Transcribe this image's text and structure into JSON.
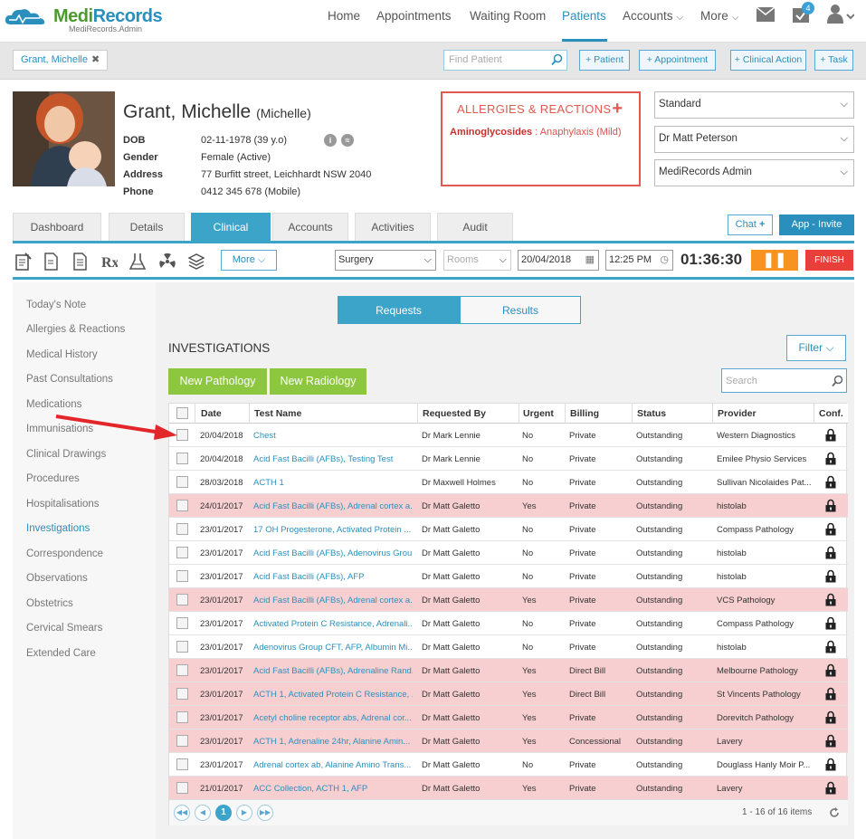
{
  "brand": {
    "name_a": "Medi",
    "name_b": "Records",
    "sub": "MediRecords.Admin"
  },
  "nav": {
    "home": "Home",
    "appointments": "Appointments",
    "waiting": "Waiting Room",
    "patients": "Patients",
    "accounts": "Accounts",
    "more": "More",
    "badge": "4"
  },
  "subbar": {
    "patient_tab": "Grant, Michelle",
    "find_placeholder": "Find Patient",
    "btn_patient": "+ Patient",
    "btn_appointment": "+ Appointment",
    "btn_clinical": "+ Clinical Action",
    "btn_task": "+ Task"
  },
  "patient": {
    "name": "Grant, Michelle",
    "nick": "(Michelle)",
    "dob_label": "DOB",
    "dob": "02-11-1978 (39 y.o)",
    "gender_label": "Gender",
    "gender": "Female (Active)",
    "address_label": "Address",
    "address": "77 Burfitt street, Leichhardt NSW 2040",
    "phone_label": "Phone",
    "phone": "0412 345 678 (Mobile)"
  },
  "allergies": {
    "title": "ALLERGIES & REACTIONS",
    "item_name": "Aminoglycosides",
    "item_reaction": " : Anaphylaxis (Mild)"
  },
  "selects": {
    "billing": "Standard",
    "doctor": "Dr Matt Peterson",
    "org": "MediRecords Admin"
  },
  "tabs": {
    "dashboard": "Dashboard",
    "details": "Details",
    "clinical": "Clinical",
    "accounts": "Accounts",
    "activities": "Activities",
    "audit": "Audit"
  },
  "tab_actions": {
    "chat": "Chat",
    "app_invite": "App - Invite"
  },
  "toolbar": {
    "more": "More",
    "location": "Surgery",
    "rooms": "Rooms",
    "date": "20/04/2018",
    "time": "12:25 PM",
    "timer": "01:36:30",
    "finish": "FINISH"
  },
  "sidebar": [
    "Today's Note",
    "Allergies & Reactions",
    "Medical History",
    "Past Consultations",
    "Medications",
    "Immunisations",
    "Clinical Drawings",
    "Procedures",
    "Hospitalisations",
    "Investigations",
    "Correspondence",
    "Observations",
    "Obstetrics",
    "Cervical Smears",
    "Extended Care"
  ],
  "segment": {
    "requests": "Requests",
    "results": "Results"
  },
  "investigations": {
    "title": "INVESTIGATIONS",
    "filter": "Filter",
    "new_pathology": "New Pathology",
    "new_radiology": "New Radiology",
    "search_placeholder": "Search"
  },
  "table": {
    "headers": {
      "date": "Date",
      "test": "Test Name",
      "requested": "Requested By",
      "urgent": "Urgent",
      "billing": "Billing",
      "status": "Status",
      "provider": "Provider",
      "conf": "Conf."
    },
    "rows": [
      {
        "date": "20/04/2018",
        "test": "Chest",
        "by": "Dr Mark Lennie",
        "urgent": "No",
        "billing": "Private",
        "status": "Outstanding",
        "provider": "Western Diagnostics",
        "pink": false
      },
      {
        "date": "20/04/2018",
        "test": "Acid Fast Bacilli (AFBs), Testing Test",
        "by": "Dr Mark Lennie",
        "urgent": "No",
        "billing": "Private",
        "status": "Outstanding",
        "provider": "Emilee Physio Services",
        "pink": false
      },
      {
        "date": "28/03/2018",
        "test": "ACTH 1",
        "by": "Dr Maxwell Holmes",
        "urgent": "No",
        "billing": "Private",
        "status": "Outstanding",
        "provider": "Sullivan Nicolaides Pat...",
        "pink": false
      },
      {
        "date": "24/01/2017",
        "test": "Acid Fast Bacilli (AFBs), Adrenal cortex a...",
        "by": "Dr Matt Galetto",
        "urgent": "Yes",
        "billing": "Private",
        "status": "Outstanding",
        "provider": "histolab",
        "pink": true
      },
      {
        "date": "23/01/2017",
        "test": "17 OH Progesterone, Activated Protein ...",
        "by": "Dr Matt Galetto",
        "urgent": "No",
        "billing": "Private",
        "status": "Outstanding",
        "provider": "Compass Pathology",
        "pink": false
      },
      {
        "date": "23/01/2017",
        "test": "Acid Fast Bacilli (AFBs), Adenovirus Grou...",
        "by": "Dr Matt Galetto",
        "urgent": "No",
        "billing": "Private",
        "status": "Outstanding",
        "provider": "histolab",
        "pink": false
      },
      {
        "date": "23/01/2017",
        "test": "Acid Fast Bacilli (AFBs), AFP",
        "by": "Dr Matt Galetto",
        "urgent": "No",
        "billing": "Private",
        "status": "Outstanding",
        "provider": "histolab",
        "pink": false
      },
      {
        "date": "23/01/2017",
        "test": "Acid Fast Bacilli (AFBs), Adrenal cortex a...",
        "by": "Dr Matt Galetto",
        "urgent": "Yes",
        "billing": "Private",
        "status": "Outstanding",
        "provider": "VCS Pathology",
        "pink": true
      },
      {
        "date": "23/01/2017",
        "test": "Activated Protein C Resistance, Adrenali...",
        "by": "Dr Matt Galetto",
        "urgent": "No",
        "billing": "Private",
        "status": "Outstanding",
        "provider": "Compass Pathology",
        "pink": false
      },
      {
        "date": "23/01/2017",
        "test": "Adenovirus Group CFT, AFP, Albumin Mi...",
        "by": "Dr Matt Galetto",
        "urgent": "No",
        "billing": "Private",
        "status": "Outstanding",
        "provider": "histolab",
        "pink": false
      },
      {
        "date": "23/01/2017",
        "test": "Acid Fast Bacilli (AFBs), Adrenaline Rand...",
        "by": "Dr Matt Galetto",
        "urgent": "Yes",
        "billing": "Direct Bill",
        "status": "Outstanding",
        "provider": "Melbourne Pathology",
        "pink": true
      },
      {
        "date": "23/01/2017",
        "test": "ACTH 1, Activated Protein C Resistance, ...",
        "by": "Dr Matt Galetto",
        "urgent": "Yes",
        "billing": "Direct Bill",
        "status": "Outstanding",
        "provider": "St Vincents Pathology",
        "pink": true
      },
      {
        "date": "23/01/2017",
        "test": "Acetyl choline receptor abs, Adrenal cor...",
        "by": "Dr Matt Galetto",
        "urgent": "Yes",
        "billing": "Private",
        "status": "Outstanding",
        "provider": "Dorevitch Pathology",
        "pink": true
      },
      {
        "date": "23/01/2017",
        "test": "ACTH 1, Adrenaline 24hr, Alanine Amin...",
        "by": "Dr Matt Galetto",
        "urgent": "Yes",
        "billing": "Concessional",
        "status": "Outstanding",
        "provider": "Lavery",
        "pink": true
      },
      {
        "date": "23/01/2017",
        "test": "Adrenal cortex ab, Alanine Amino Trans...",
        "by": "Dr Matt Galetto",
        "urgent": "No",
        "billing": "Private",
        "status": "Outstanding",
        "provider": "Douglass Hanly Moir P...",
        "pink": false
      },
      {
        "date": "21/01/2017",
        "test": "ACC Collection, ACTH 1, AFP",
        "by": "Dr Matt Galetto",
        "urgent": "Yes",
        "billing": "Private",
        "status": "Outstanding",
        "provider": "Lavery",
        "pink": true
      }
    ]
  },
  "pager": {
    "page": "1",
    "info": "1 - 16 of 16 items"
  },
  "colors": {
    "accent": "#3ca4c8",
    "link": "#2a8fbd",
    "green": "#8dc63f",
    "pink_row": "#f8cfd0",
    "alert": "#e05a4f",
    "pause": "#f7931e",
    "finish": "#e83f3a"
  }
}
